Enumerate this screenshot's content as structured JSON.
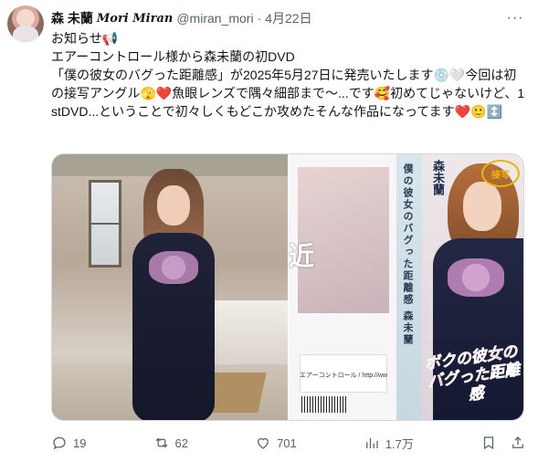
{
  "author": {
    "display_name": "森 未蘭",
    "display_name_latin": "Mori Miran",
    "handle": "@miran_mori",
    "separator": "·",
    "date": "4月22日"
  },
  "more_label": "···",
  "tweet_text": "お知らせ📢\nエアーコントロール様から森未蘭の初DVD\n「僕の彼女のバグった距離感」が2025年5月27日に発売いたします💿🤍今回は初の接写アングル🫣❤️魚眼レンズで隅々細部まで〜...です🥰初めてじゃないけど、1stDVD...ということで初々しくもどこか攻めたそんな作品になってます❤️🙂↕️",
  "media": {
    "cover_title": "ボクの彼女のバグった距離感",
    "cover_name": "森未蘭",
    "cover_badge": "接写",
    "spine_title": "僕の彼女のバグった距離感 森未蘭",
    "back_big_text": "近",
    "back_url": "エアーコントロール / http://www.i-dol.tv/"
  },
  "actions": {
    "reply_count": "19",
    "retweet_count": "62",
    "like_count": "701",
    "views_count": "1.7万"
  }
}
